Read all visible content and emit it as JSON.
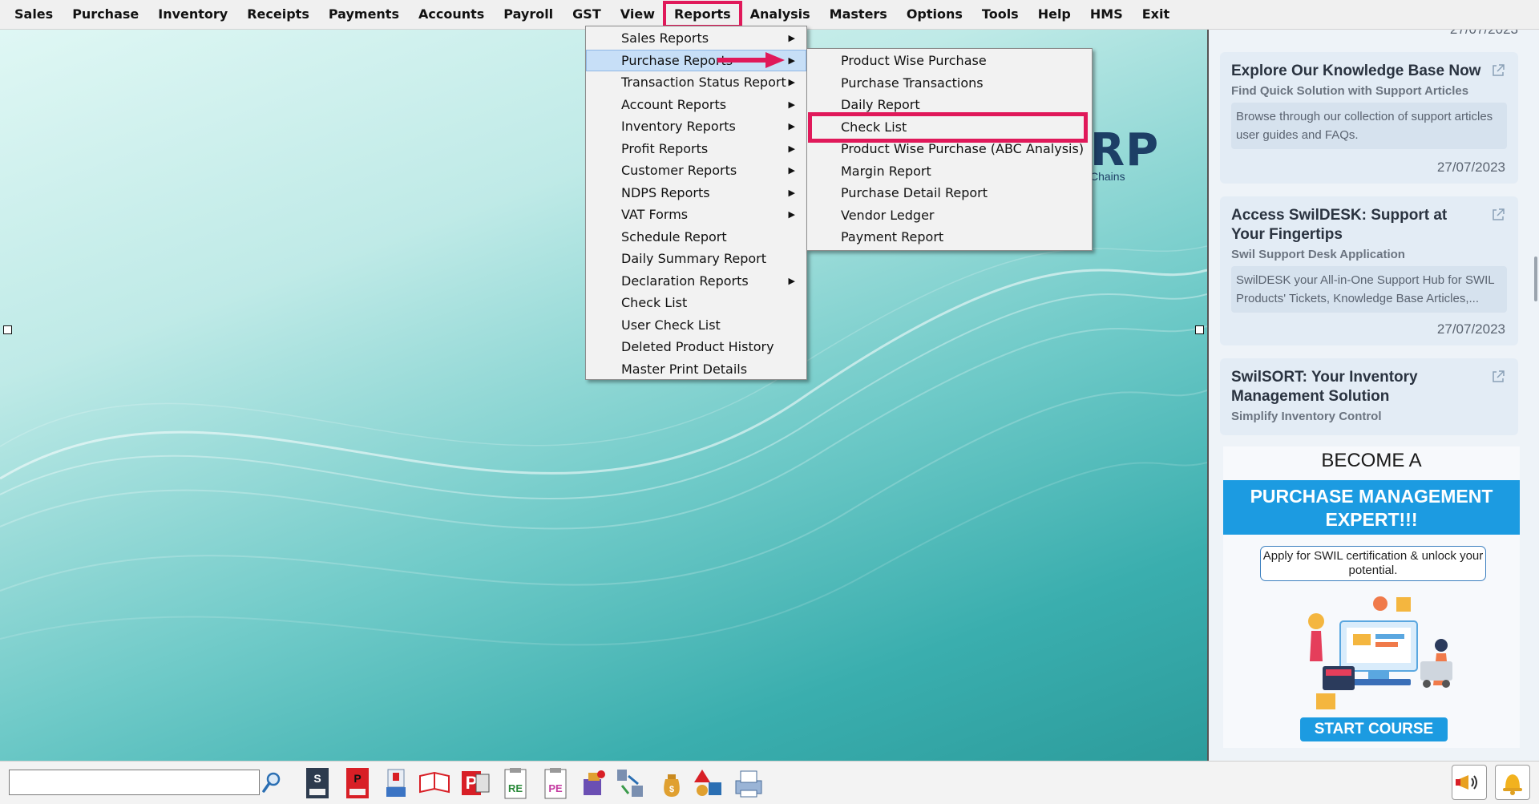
{
  "menubar": {
    "items": [
      "Sales",
      "Purchase",
      "Inventory",
      "Receipts",
      "Payments",
      "Accounts",
      "Payroll",
      "GST",
      "View",
      "Reports",
      "Analysis",
      "Masters",
      "Options",
      "Tools",
      "Help",
      "HMS",
      "Exit"
    ],
    "active": "Reports"
  },
  "reports_menu": {
    "items": [
      {
        "label": "Sales Reports",
        "submenu": true
      },
      {
        "label": "Purchase Reports",
        "submenu": true
      },
      {
        "label": "Transaction Status Report",
        "submenu": true
      },
      {
        "label": "Account Reports",
        "submenu": true
      },
      {
        "label": "Inventory Reports",
        "submenu": true
      },
      {
        "label": "Profit Reports",
        "submenu": true
      },
      {
        "label": "Customer Reports",
        "submenu": true
      },
      {
        "label": "NDPS Reports",
        "submenu": true
      },
      {
        "label": "VAT Forms",
        "submenu": true
      },
      {
        "label": "Schedule Report",
        "submenu": false
      },
      {
        "label": "Daily Summary Report",
        "submenu": false
      },
      {
        "label": "Declaration Reports",
        "submenu": true
      },
      {
        "label": "Check List",
        "submenu": false
      },
      {
        "label": "User Check List",
        "submenu": false
      },
      {
        "label": "Deleted Product History",
        "submenu": false
      },
      {
        "label": "Master Print Details",
        "submenu": false
      }
    ],
    "highlighted": "Purchase Reports"
  },
  "purchase_submenu": {
    "items": [
      "Product Wise Purchase",
      "Purchase Transactions",
      "Daily Report",
      "Check List",
      "Product Wise Purchase (ABC Analysis)",
      "Margin Report",
      "Purchase Detail Report",
      "Vendor Ledger",
      "Payment Report"
    ],
    "marked": "Check List"
  },
  "background": {
    "logo_fragment": "RP",
    "logo_tag": "Chains"
  },
  "sidebar": {
    "top_date_partial": "27/07/2023",
    "cards": [
      {
        "title": "Explore Our Knowledge Base Now",
        "subtitle": "Find Quick Solution with Support Articles",
        "desc": "Browse through our collection of support articles user guides and FAQs.",
        "date": "27/07/2023"
      },
      {
        "title": "Access SwilDESK: Support at Your Fingertips",
        "subtitle": "Swil Support Desk Application",
        "desc": "SwilDESK your All-in-One Support Hub for SWIL Products' Tickets, Knowledge Base Articles,...",
        "date": "27/07/2023"
      },
      {
        "title": "SwilSORT: Your Inventory Management Solution",
        "subtitle": "Simplify Inventory Control"
      }
    ],
    "promo": {
      "become": "BECOME A",
      "banner": "PURCHASE MANAGEMENT EXPERT!!!",
      "apply": "Apply for SWIL certification & unlock your potential.",
      "button": "START COURSE"
    }
  },
  "toolbar": {
    "search_value": "",
    "icons": [
      "sale-entry-icon",
      "purchase-entry-icon",
      "product-icon",
      "order-book-icon",
      "print-icon",
      "receipt-entry-icon",
      "payment-entry-icon",
      "dispatch-icon",
      "stock-transfer-icon",
      "money-bag-icon",
      "shapes-icon",
      "printer-icon"
    ],
    "right_icons": [
      "announcement-icon",
      "notification-bell-icon"
    ]
  },
  "colors": {
    "highlight_red": "#e0195a",
    "menu_hover": "#c7dff7",
    "brand_blue": "#1c9be1"
  }
}
